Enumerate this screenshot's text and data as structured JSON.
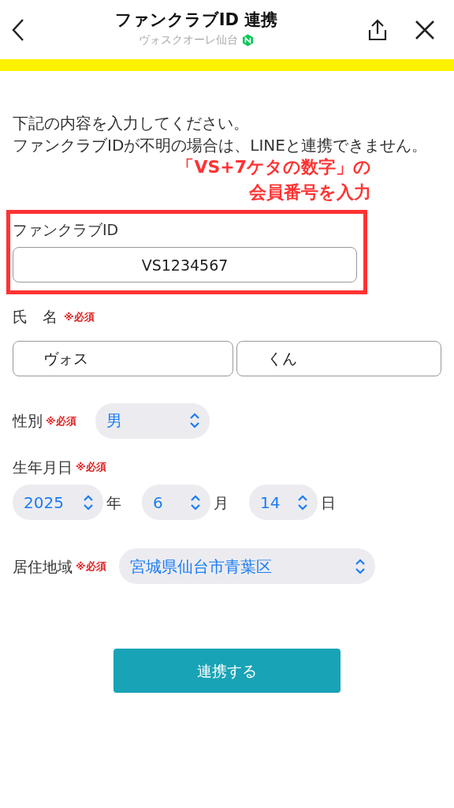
{
  "header": {
    "title": "ファンクラブID 連携",
    "subtitle": "ヴォスクオーレ仙台",
    "verified": true
  },
  "intro": [
    "下記の内容を入力してください。",
    "ファンクラブIDが不明の場合は、LINEと連携できません。"
  ],
  "annotation": {
    "lines": [
      "「VS+7ケタの数字」の",
      "会員番号を入力"
    ]
  },
  "fan_id": {
    "label": "ファンクラブID",
    "value": "VS1234567",
    "highlighted": true
  },
  "name": {
    "label": "氏　名",
    "required": "※必須",
    "values": [
      "ヴォス",
      "くん"
    ]
  },
  "gender": {
    "label": "性別",
    "required": "※必須",
    "value": "男"
  },
  "birthdate": {
    "label": "生年月日",
    "required": "※必須",
    "parts": [
      {
        "value": "2025",
        "unit": "年"
      },
      {
        "value": "6",
        "unit": "月"
      },
      {
        "value": "14",
        "unit": "日"
      }
    ]
  },
  "region": {
    "label": "居住地域",
    "required": "※必須",
    "value": "宮城県仙台市青葉区"
  },
  "submit": "連携する"
}
